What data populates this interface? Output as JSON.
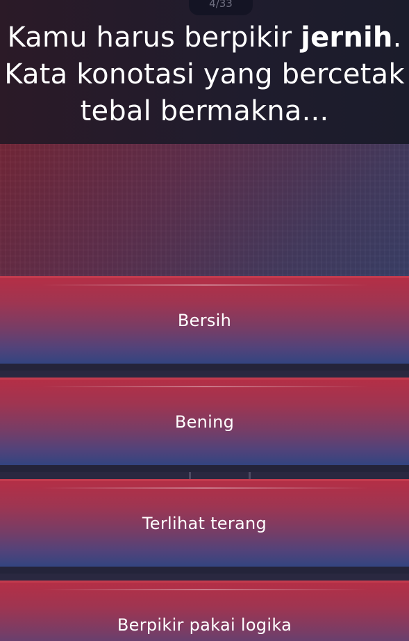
{
  "progress": "4/33",
  "question": {
    "line1_prefix": "Kamu harus berpikir ",
    "line1_bold": "jernih",
    "line1_suffix": ".",
    "line2": "Kata konotasi yang bercetak",
    "line3": "tebal bermakna..."
  },
  "answers": [
    {
      "label": "Bersih"
    },
    {
      "label": "Bening"
    },
    {
      "label": "Terlihat terang"
    },
    {
      "label": "Berpikir pakai logika"
    }
  ],
  "colors": {
    "answer_top": "#b62e45",
    "answer_bottom": "#334480",
    "question_bg": "#1f1c2d"
  }
}
